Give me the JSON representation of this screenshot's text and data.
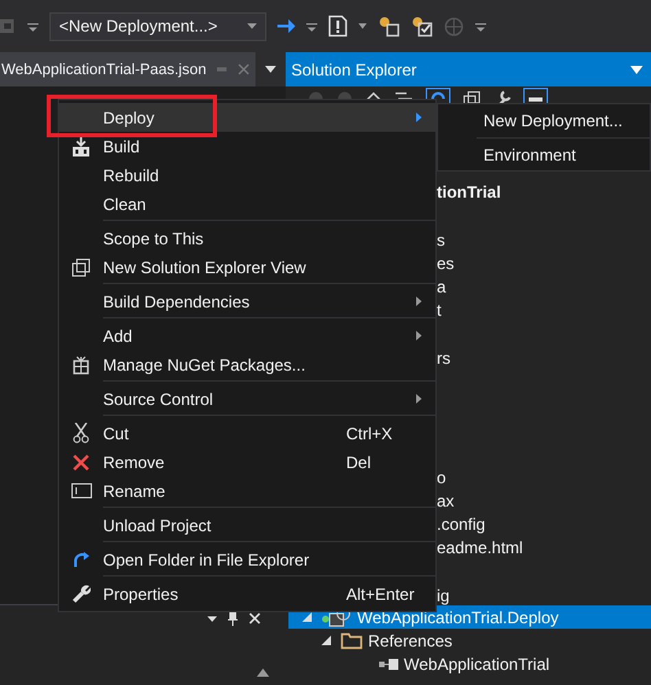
{
  "toolbar": {
    "configuration": {
      "value": "<New Deployment...>"
    }
  },
  "document_tab": {
    "title": "WebApplicationTrial-Paas.json"
  },
  "solution_explorer": {
    "title": "Solution Explorer",
    "partial_items": [
      {
        "text": "tionTrial",
        "bold": true
      },
      {
        "text": "s",
        "bold": false
      },
      {
        "text": "es",
        "bold": false
      },
      {
        "text": "a",
        "bold": false
      },
      {
        "text": "t",
        "bold": false
      },
      {
        "text": "rs",
        "bold": false
      },
      {
        "text": "o",
        "bold": false
      },
      {
        "text": "ax",
        "bold": false
      },
      {
        "text": ".config",
        "bold": false
      },
      {
        "text": "eadme.html",
        "bold": false
      },
      {
        "text": "ig",
        "bold": false
      }
    ],
    "tree": [
      {
        "label": "WebApplicationTrial.Deploy",
        "selected": true,
        "expanded": true,
        "children": [
          {
            "label": "References",
            "selected": false,
            "expanded": true,
            "children": [
              {
                "label": "WebApplicationTrial",
                "selected": false
              }
            ]
          }
        ]
      }
    ]
  },
  "context_menu": {
    "items": [
      {
        "kind": "item",
        "label": "Deploy",
        "selected": true,
        "outlined": true,
        "has_submenu": true
      },
      {
        "kind": "item",
        "label": "Build",
        "selected": false,
        "outlined": false,
        "has_submenu": false
      },
      {
        "kind": "item",
        "label": "Rebuild",
        "selected": false,
        "outlined": false,
        "has_submenu": false
      },
      {
        "kind": "item",
        "label": "Clean",
        "selected": false,
        "outlined": false,
        "has_submenu": false
      },
      {
        "kind": "separator"
      },
      {
        "kind": "item",
        "label": "Scope to This",
        "selected": false,
        "outlined": false,
        "has_submenu": false
      },
      {
        "kind": "item",
        "label": "New Solution Explorer View",
        "selected": false,
        "outlined": false,
        "has_submenu": false
      },
      {
        "kind": "separator"
      },
      {
        "kind": "item",
        "label": "Build Dependencies",
        "selected": false,
        "outlined": false,
        "has_submenu": true
      },
      {
        "kind": "separator"
      },
      {
        "kind": "item",
        "label": "Add",
        "selected": false,
        "outlined": false,
        "has_submenu": true
      },
      {
        "kind": "item",
        "label": "Manage NuGet Packages...",
        "selected": false,
        "outlined": false,
        "has_submenu": false
      },
      {
        "kind": "separator"
      },
      {
        "kind": "item",
        "label": "Source Control",
        "selected": false,
        "outlined": false,
        "has_submenu": true
      },
      {
        "kind": "separator"
      },
      {
        "kind": "item",
        "label": "Cut",
        "shortcut": "Ctrl+X",
        "selected": false,
        "outlined": false,
        "has_submenu": false
      },
      {
        "kind": "item",
        "label": "Remove",
        "shortcut": "Del",
        "selected": false,
        "outlined": false,
        "has_submenu": false
      },
      {
        "kind": "item",
        "label": "Rename",
        "selected": false,
        "outlined": false,
        "has_submenu": false
      },
      {
        "kind": "separator"
      },
      {
        "kind": "item",
        "label": "Unload Project",
        "selected": false,
        "outlined": false,
        "has_submenu": false
      },
      {
        "kind": "separator"
      },
      {
        "kind": "item",
        "label": "Open Folder in File Explorer",
        "selected": false,
        "outlined": false,
        "has_submenu": false
      },
      {
        "kind": "separator"
      },
      {
        "kind": "item",
        "label": "Properties",
        "shortcut": "Alt+Enter",
        "selected": false,
        "outlined": false,
        "has_submenu": false
      }
    ]
  },
  "submenu": {
    "items": [
      {
        "kind": "item",
        "label": "New Deployment...",
        "selected": false
      },
      {
        "kind": "separator"
      },
      {
        "kind": "item",
        "label": "Environment",
        "selected": false
      }
    ]
  }
}
